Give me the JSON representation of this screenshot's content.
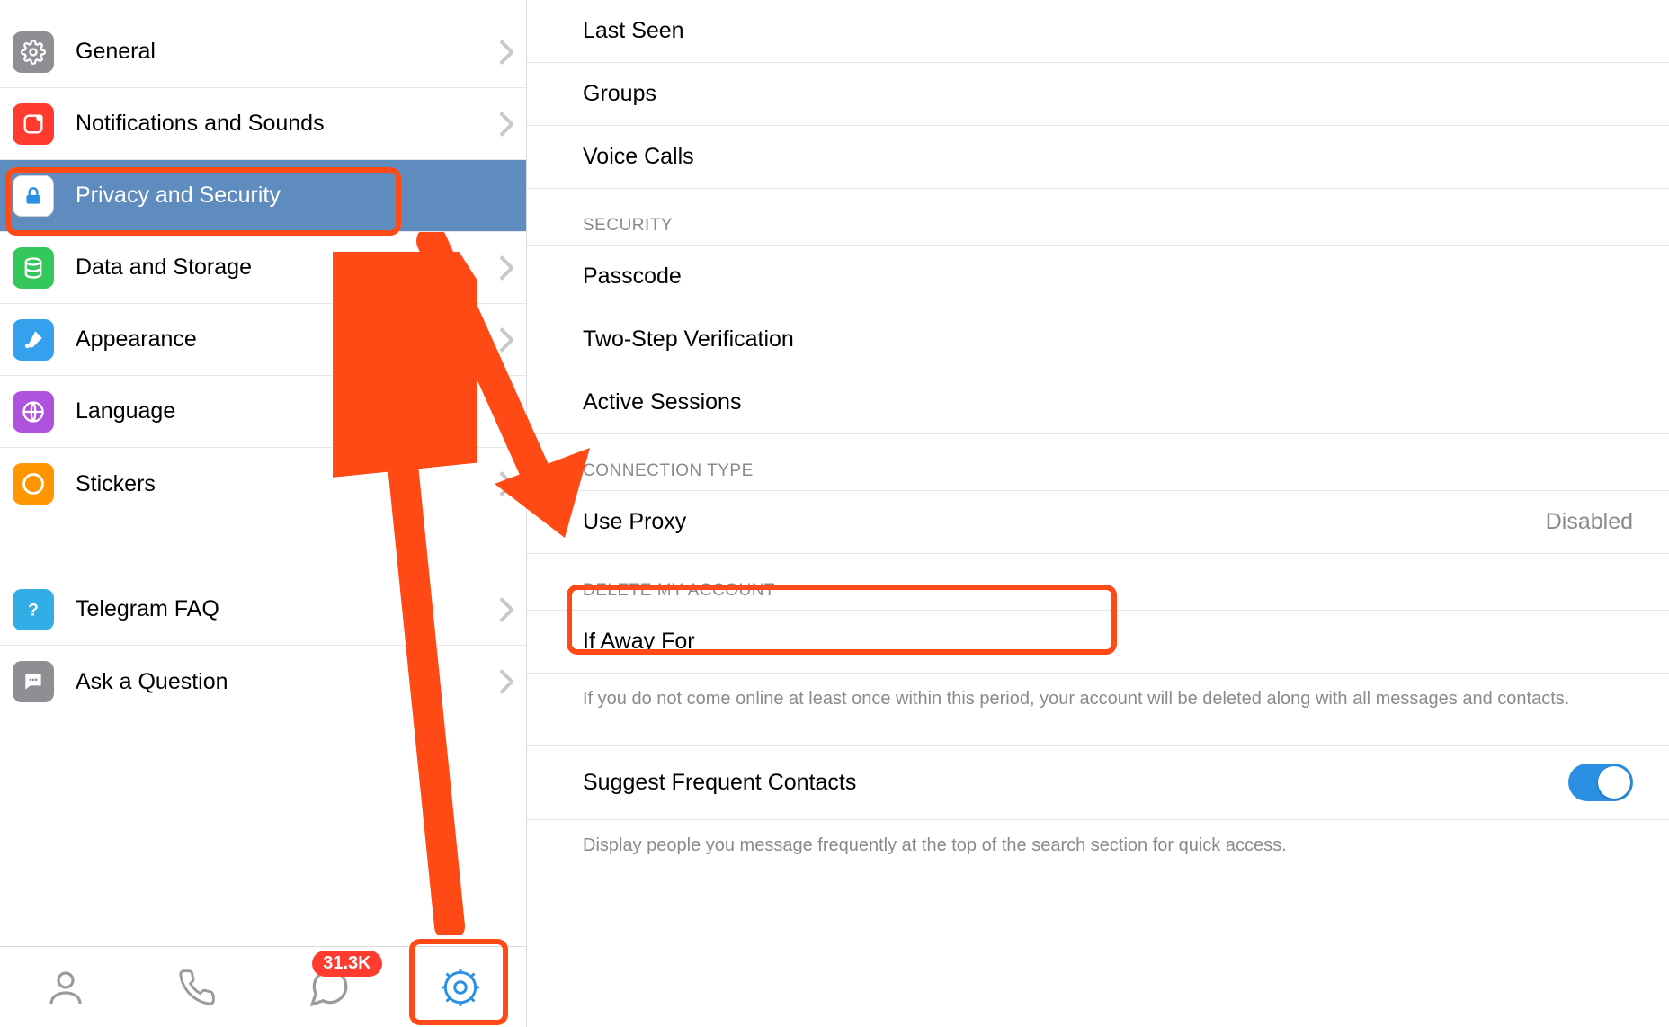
{
  "sidebar": {
    "items": [
      {
        "id": "general",
        "label": "General",
        "icon": "gear-icon",
        "color": "ic-gray",
        "selected": false
      },
      {
        "id": "notif",
        "label": "Notifications and Sounds",
        "icon": "bell-icon",
        "color": "ic-red",
        "selected": false
      },
      {
        "id": "privacy",
        "label": "Privacy and Security",
        "icon": "lock-icon",
        "color": "ic-white",
        "selected": true
      },
      {
        "id": "data",
        "label": "Data and Storage",
        "icon": "database-icon",
        "color": "ic-green",
        "selected": false
      },
      {
        "id": "appear",
        "label": "Appearance",
        "icon": "brush-icon",
        "color": "ic-paint",
        "selected": false
      },
      {
        "id": "lang",
        "label": "Language",
        "icon": "globe-icon",
        "color": "ic-purple",
        "selected": false
      },
      {
        "id": "stickers",
        "label": "Stickers",
        "icon": "sticker-icon",
        "color": "ic-orange",
        "selected": false
      }
    ],
    "help_items": [
      {
        "id": "faq",
        "label": "Telegram FAQ",
        "icon": "question-icon",
        "color": "ic-cyan"
      },
      {
        "id": "ask",
        "label": "Ask a Question",
        "icon": "chat-icon",
        "color": "ic-gray"
      }
    ]
  },
  "tabbar": {
    "badge": "31.3K"
  },
  "content": {
    "privacy_rows": [
      {
        "label": "Last Seen"
      },
      {
        "label": "Groups"
      },
      {
        "label": "Voice Calls"
      }
    ],
    "security": {
      "header": "Security",
      "rows": [
        {
          "label": "Passcode"
        },
        {
          "label": "Two-Step Verification"
        },
        {
          "label": "Active Sessions"
        }
      ]
    },
    "connection": {
      "header": "Connection Type",
      "proxy_label": "Use Proxy",
      "proxy_value": "Disabled"
    },
    "delete": {
      "header": "Delete My Account",
      "row_label": "If Away For",
      "note": "If you do not come online at least once within this period, your account will be deleted along with all messages and contacts."
    },
    "suggest": {
      "label": "Suggest Frequent Contacts",
      "note": "Display people you message frequently at the top of the search section for quick access."
    }
  },
  "colors": {
    "annotation": "#ff4a16",
    "selected_bg": "#5f8cbf",
    "accent": "#2b8fe3"
  }
}
